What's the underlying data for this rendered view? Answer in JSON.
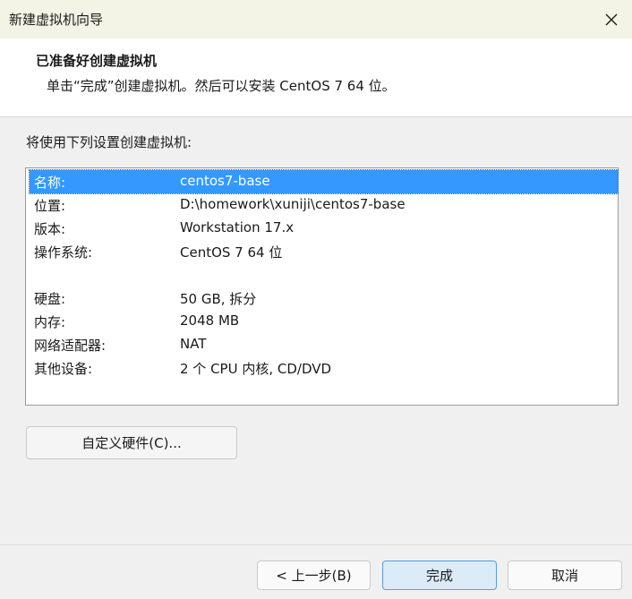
{
  "window": {
    "title": "新建虚拟机向导"
  },
  "header": {
    "title": "已准备好创建虚拟机",
    "subtitle": "单击“完成”创建虚拟机。然后可以安装 CentOS 7 64 位。"
  },
  "content": {
    "intro": "将使用下列设置创建虚拟机:",
    "settings": [
      {
        "key": "名称:",
        "value": "centos7-base",
        "selected": true
      },
      {
        "key": "位置:",
        "value": "D:\\homework\\xuniji\\centos7-base"
      },
      {
        "key": "版本:",
        "value": "Workstation 17.x"
      },
      {
        "key": "操作系统:",
        "value": "CentOS 7 64 位"
      },
      {
        "key": "",
        "value": ""
      },
      {
        "key": "硬盘:",
        "value": "50 GB, 拆分"
      },
      {
        "key": "内存:",
        "value": "2048 MB"
      },
      {
        "key": "网络适配器:",
        "value": "NAT"
      },
      {
        "key": "其他设备:",
        "value": "2 个 CPU 内核, CD/DVD"
      }
    ],
    "customize_button": "自定义硬件(C)..."
  },
  "footer": {
    "back_button": "< 上一步(B)",
    "finish_button": "完成",
    "cancel_button": "取消"
  },
  "colors": {
    "selection": "#3399ff",
    "titlebar": "#f3f3e6",
    "primary_button": "#dcebf8"
  },
  "icons": {
    "close": "close-icon"
  }
}
